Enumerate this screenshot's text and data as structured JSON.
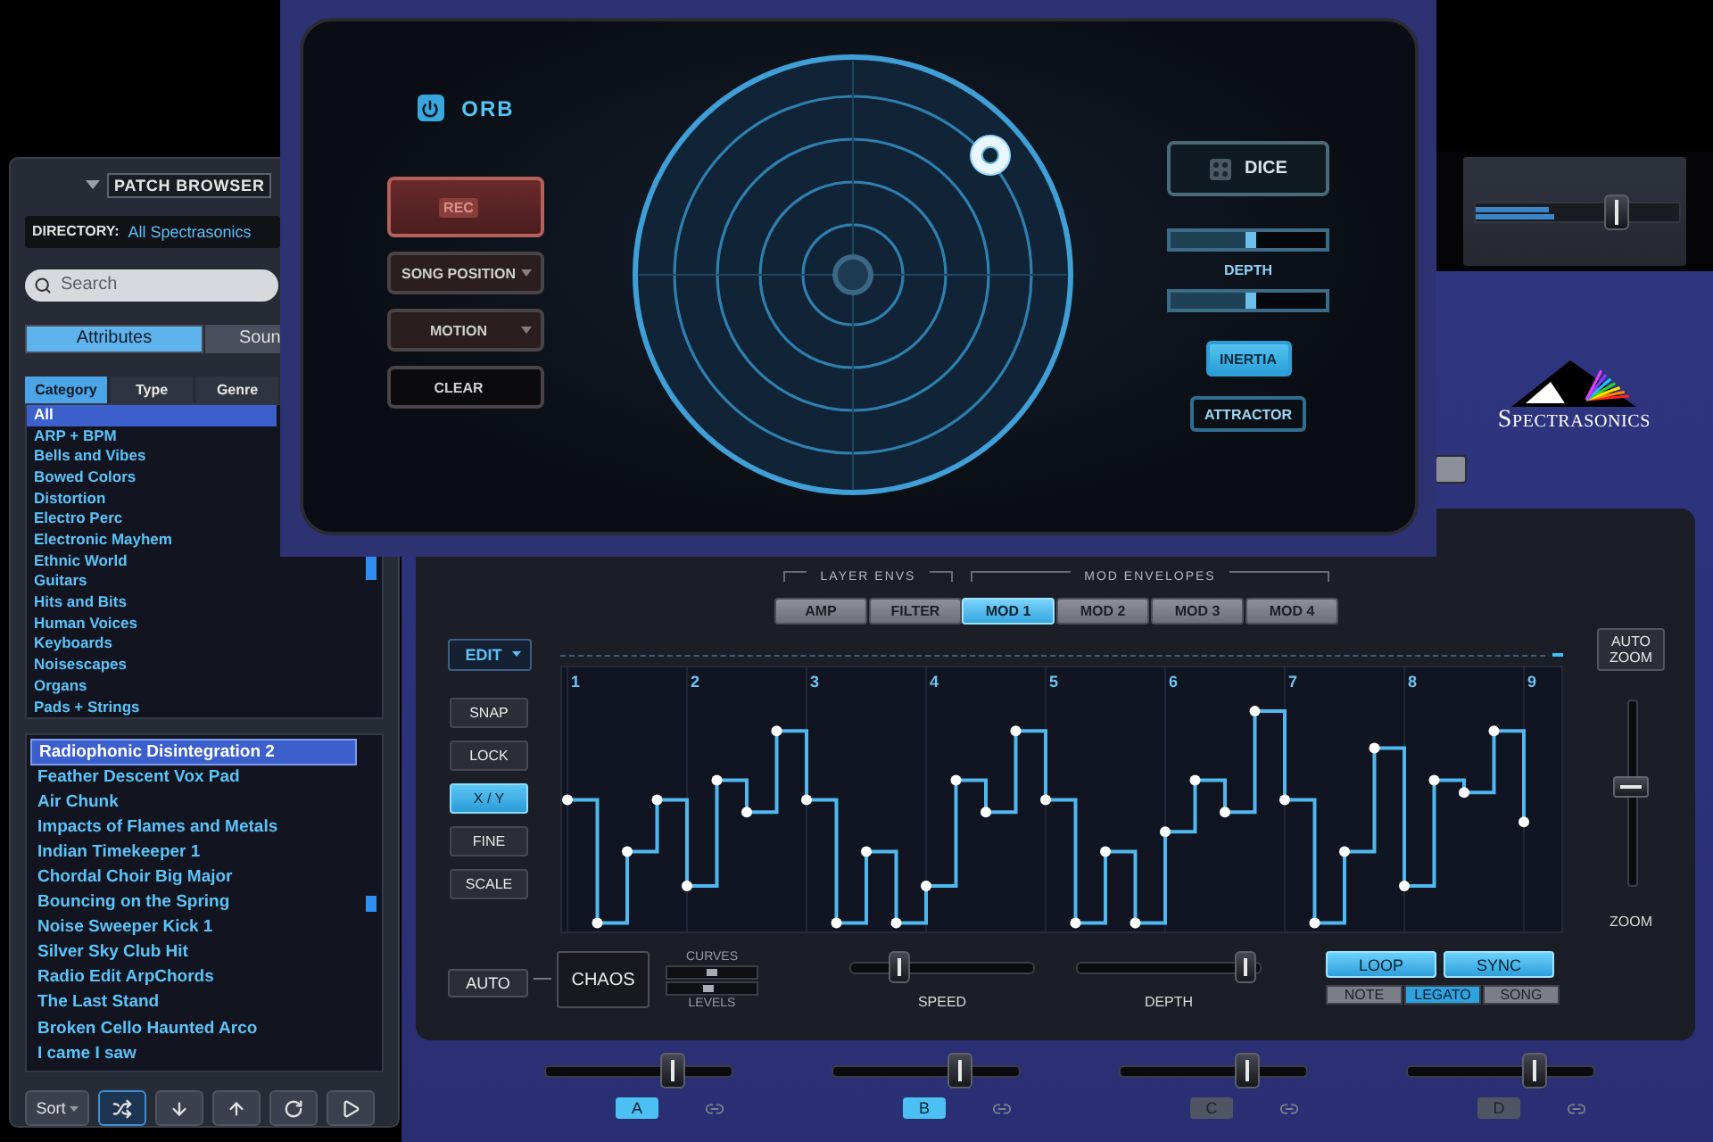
{
  "orb": {
    "title": "ORB",
    "power_on": true,
    "left_buttons": [
      {
        "kind": "rec",
        "label": "REC"
      },
      {
        "kind": "dropdown",
        "label": "SONG POSITION"
      },
      {
        "kind": "dropdown",
        "label": "MOTION"
      },
      {
        "kind": "plain",
        "label": "CLEAR"
      }
    ],
    "dice": "DICE",
    "depth_label": "DEPTH",
    "depth_sliders": [
      {
        "level": 0.52
      },
      {
        "level": 0.52
      }
    ],
    "toggles": [
      {
        "label": "INERTIA",
        "on": true
      },
      {
        "label": "ATTRACTOR",
        "on": false
      }
    ]
  },
  "browser": {
    "title": "PATCH BROWSER",
    "directory_label": "DIRECTORY:",
    "directory": "All Spectrasonics",
    "search_placeholder": "Search",
    "views": [
      {
        "label": "Attributes",
        "selected": true
      },
      {
        "label": "Soun",
        "selected": false
      }
    ],
    "filters": [
      {
        "label": "Category",
        "selected": true
      },
      {
        "label": "Type",
        "selected": false
      },
      {
        "label": "Genre",
        "selected": false
      }
    ],
    "categories": [
      {
        "label": "All",
        "selected": true
      },
      {
        "label": "ARP + BPM",
        "selected": false
      },
      {
        "label": "Bells and Vibes",
        "selected": false
      },
      {
        "label": "Bowed Colors",
        "selected": false
      },
      {
        "label": "Distortion",
        "selected": false
      },
      {
        "label": "Electro Perc",
        "selected": false
      },
      {
        "label": "Electronic Mayhem",
        "selected": false
      },
      {
        "label": "Ethnic World",
        "selected": false
      },
      {
        "label": "Guitars",
        "selected": false
      },
      {
        "label": "Hits and Bits",
        "selected": false
      },
      {
        "label": "Human Voices",
        "selected": false
      },
      {
        "label": "Keyboards",
        "selected": false
      },
      {
        "label": "Noisescapes",
        "selected": false
      },
      {
        "label": "Organs",
        "selected": false
      },
      {
        "label": "Pads + Strings",
        "selected": false
      }
    ],
    "patches": [
      {
        "label": "Radiophonic Disintegration 2",
        "selected": true
      },
      {
        "label": "Feather Descent Vox Pad",
        "selected": false
      },
      {
        "label": "Air Chunk",
        "selected": false
      },
      {
        "label": "Impacts of Flames and Metals",
        "selected": false
      },
      {
        "label": "Indian Timekeeper 1",
        "selected": false
      },
      {
        "label": "Chordal Choir Big Major",
        "selected": false
      },
      {
        "label": "Bouncing on the Spring",
        "selected": false
      },
      {
        "label": "Noise Sweeper Kick 1",
        "selected": false
      },
      {
        "label": "Silver Sky Club Hit",
        "selected": false
      },
      {
        "label": "Radio Edit ArpChords",
        "selected": false
      },
      {
        "label": "The Last Stand",
        "selected": false
      },
      {
        "label": "Broken Cello Haunted Arco",
        "selected": false
      },
      {
        "label": "I came I saw",
        "selected": false
      }
    ],
    "toolbar": [
      {
        "kind": "sort",
        "label": "Sort"
      },
      {
        "kind": "shuffle",
        "on": true
      },
      {
        "kind": "down",
        "on": false
      },
      {
        "kind": "up",
        "on": false
      },
      {
        "kind": "refresh",
        "on": false
      },
      {
        "kind": "play",
        "on": false
      }
    ]
  },
  "master": {
    "level": 0.72,
    "meter": [
      {
        "level": 0.36
      },
      {
        "level": 0.39
      }
    ]
  },
  "logo": "SPECTRASONICS",
  "mod": {
    "groups": [
      {
        "label": "LAYER ENVS",
        "tabs": [
          {
            "label": "AMP",
            "selected": false
          },
          {
            "label": "FILTER",
            "selected": false
          }
        ]
      },
      {
        "label": "MOD ENVELOPES",
        "tabs": [
          {
            "label": "MOD 1",
            "selected": true
          },
          {
            "label": "MOD 2",
            "selected": false
          },
          {
            "label": "MOD 3",
            "selected": false
          },
          {
            "label": "MOD 4",
            "selected": false
          }
        ]
      }
    ],
    "edit": "EDIT",
    "tools": [
      {
        "label": "SNAP",
        "on": false
      },
      {
        "label": "LOCK",
        "on": false
      },
      {
        "label": "X / Y",
        "on": true
      },
      {
        "label": "FINE",
        "on": false
      },
      {
        "label": "SCALE",
        "on": false
      }
    ],
    "steps": [
      "1",
      "2",
      "3",
      "4",
      "5",
      "6",
      "7",
      "8",
      "9"
    ],
    "auto_zoom": "AUTO ZOOM",
    "zoom": {
      "label": "ZOOM",
      "level": 0.54
    },
    "auto": "AUTO",
    "chaos": "CHAOS",
    "curves": {
      "label": "CURVES",
      "level": 0.5
    },
    "levels": {
      "label": "LEVELS",
      "level": 0.45
    },
    "speed": {
      "label": "SPEED",
      "level": 0.24
    },
    "depth": {
      "label": "DEPTH",
      "level": 0.97
    },
    "loop": {
      "label": "LOOP",
      "on": true
    },
    "sync": {
      "label": "SYNC",
      "on": true
    },
    "modes": [
      {
        "label": "NOTE",
        "selected": false
      },
      {
        "label": "LEGATO",
        "selected": true
      },
      {
        "label": "SONG",
        "selected": false
      }
    ]
  },
  "macros": [
    {
      "label": "A",
      "on": true,
      "level": 0.71
    },
    {
      "label": "B",
      "on": true,
      "level": 0.71
    },
    {
      "label": "C",
      "on": false,
      "level": 0.71
    },
    {
      "label": "D",
      "on": false,
      "level": 0.71
    }
  ]
}
